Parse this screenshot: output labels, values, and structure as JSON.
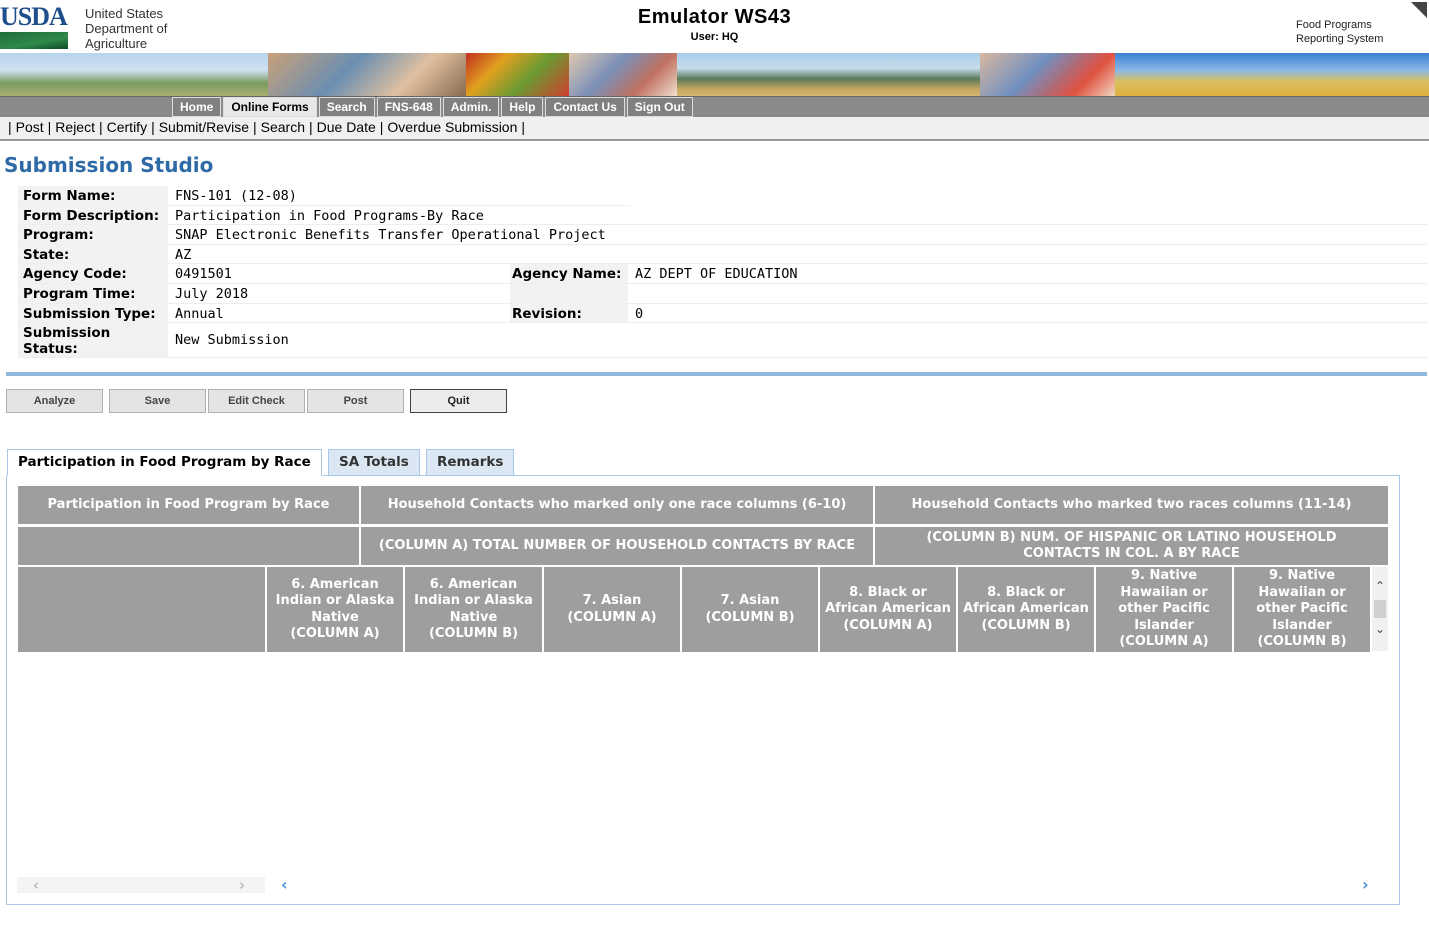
{
  "header": {
    "logo_text": "USDA",
    "agency_lines": [
      "United States",
      "Department of",
      "Agriculture"
    ],
    "title": "Emulator WS43",
    "user": "User: HQ",
    "system_lines": [
      "Food Programs",
      "Reporting System"
    ]
  },
  "nav": {
    "items": [
      "Home",
      "Online Forms",
      "Search",
      "FNS-648",
      "Admin.",
      "Help",
      "Contact Us",
      "Sign Out"
    ],
    "active": "Online Forms"
  },
  "subnav": {
    "items": [
      "Post",
      "Reject",
      "Certify",
      "Submit/Revise",
      "Search",
      "Due Date",
      "Overdue Submission"
    ]
  },
  "page_title": "Submission Studio",
  "info": {
    "form_name_label": "Form Name:",
    "form_name": "FNS-101 (12-08)",
    "form_desc_label": "Form Description:",
    "form_desc": "Participation in Food Programs-By Race",
    "program_label": "Program:",
    "program": "SNAP Electronic Benefits Transfer Operational Project",
    "state_label": "State:",
    "state": "AZ",
    "agency_code_label": "Agency Code:",
    "agency_code": "0491501",
    "agency_name_label": "Agency Name:",
    "agency_name": "AZ DEPT OF EDUCATION",
    "program_time_label": "Program Time:",
    "program_time": "July 2018",
    "submission_type_label": "Submission Type:",
    "submission_type": "Annual",
    "revision_label": "Revision:",
    "revision": "0",
    "submission_status_label_1": "Submission",
    "submission_status_label_2": "Status:",
    "submission_status": "New Submission"
  },
  "buttons": [
    "Analyze",
    "Save",
    "Edit Check",
    "Post",
    "Quit"
  ],
  "tabs": [
    "Participation in Food Program by Race",
    "SA Totals",
    "Remarks"
  ],
  "grid": {
    "title": "Participation in Food Program by Race",
    "group1": "Household Contacts who marked only one race columns (6-10)",
    "group2": "Household Contacts who marked two races columns (11-14)",
    "sub1": "(COLUMN A) TOTAL NUMBER OF HOUSEHOLD CONTACTS BY RACE",
    "sub2_line1": "(COLUMN B) NUM. OF HISPANIC OR LATINO HOUSEHOLD",
    "sub2_line2": "CONTACTS IN COL. A BY RACE",
    "columns": [
      [
        "6. American",
        "Indian or Alaska",
        "Native",
        "(COLUMN A)"
      ],
      [
        "6. American",
        "Indian or Alaska",
        "Native",
        "(COLUMN B)"
      ],
      [
        "7. Asian",
        "(COLUMN A)"
      ],
      [
        "7. Asian",
        "(COLUMN B)"
      ],
      [
        "8. Black or",
        "African American",
        "(COLUMN A)"
      ],
      [
        "8. Black or",
        "African American",
        "(COLUMN B)"
      ],
      [
        "9. Native",
        "Hawaiian or",
        "other Pacific",
        "Islander",
        "(COLUMN A)"
      ],
      [
        "9. Native",
        "Hawaiian or",
        "other Pacific",
        "Islander",
        "(COLUMN B)"
      ]
    ]
  },
  "icons": {
    "scroll_up": "chevron-up-icon",
    "scroll_down": "chevron-down-icon",
    "scroll_left": "chevron-left-icon",
    "scroll_right": "chevron-right-icon"
  },
  "colors": {
    "title_blue": "#2e6aa6",
    "grid_header_gray": "#9e9e9e",
    "nav_gray": "#808080",
    "tab_border": "#a8c8e8"
  }
}
